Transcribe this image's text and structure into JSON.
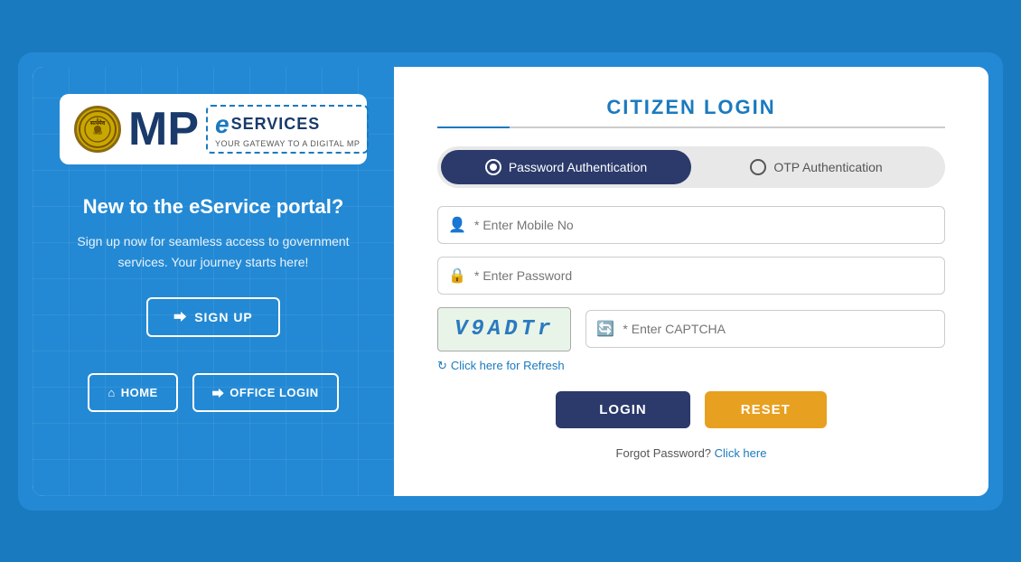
{
  "outer": {
    "background_color": "#2389d4"
  },
  "left": {
    "logo": {
      "mp_text": "MP",
      "e_text": "e",
      "services_text": "SERVICES",
      "tagline": "YOUR GATEWAY TO A DIGITAL MP"
    },
    "heading": "New to the eService portal?",
    "subtext": "Sign up now for seamless access to government services. Your journey starts here!",
    "signup_label": "SIGN UP",
    "home_label": "HOME",
    "office_login_label": "OFFICE LOGIN"
  },
  "right": {
    "title": "CITIZEN LOGIN",
    "auth_options": [
      {
        "label": "Password Authentication",
        "active": true
      },
      {
        "label": "OTP Authentication",
        "active": false
      }
    ],
    "mobile_placeholder": "* Enter Mobile No",
    "password_placeholder": "* Enter Password",
    "captcha_value": "V9ADTr",
    "captcha_placeholder": "* Enter CAPTCHA",
    "refresh_text": "Click here for Refresh",
    "login_label": "LOGIN",
    "reset_label": "RESET",
    "forgot_static": "Forgot Password?",
    "forgot_link": "Click here"
  }
}
